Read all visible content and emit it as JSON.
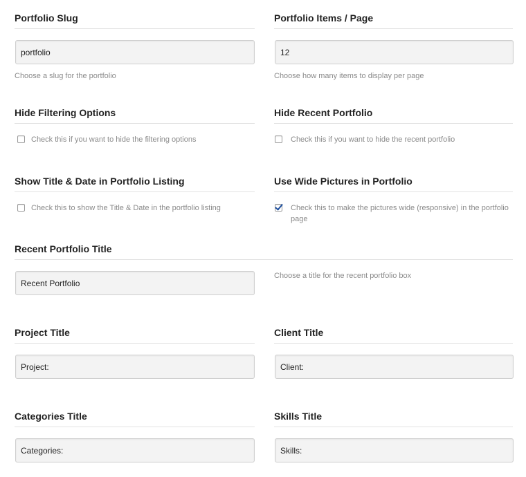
{
  "fields": {
    "portfolio_slug": {
      "title": "Portfolio Slug",
      "value": "portfolio",
      "description": "Choose a slug for the portfolio"
    },
    "items_per_page": {
      "title": "Portfolio Items / Page",
      "value": "12",
      "description": "Choose how many items to display per page"
    },
    "hide_filtering": {
      "title": "Hide Filtering Options",
      "checked": false,
      "description": "Check this if you want to hide the filtering options"
    },
    "hide_recent": {
      "title": "Hide Recent Portfolio",
      "checked": false,
      "description": "Check this if you want to hide the recent portfolio"
    },
    "show_title_date": {
      "title": "Show Title & Date in Portfolio Listing",
      "checked": false,
      "description": "Check this to show the Title & Date in the portfolio listing"
    },
    "wide_pictures": {
      "title": "Use Wide Pictures in Portfolio",
      "checked": true,
      "description": "Check this to make the pictures wide (responsive) in the portfolio page"
    },
    "recent_title": {
      "title": "Recent Portfolio Title",
      "value": "Recent Portfolio",
      "description": "Choose a title for the recent portfolio box"
    },
    "project_title": {
      "title": "Project Title",
      "value": "Project:"
    },
    "client_title": {
      "title": "Client Title",
      "value": "Client:"
    },
    "categories_title": {
      "title": "Categories Title",
      "value": "Categories:"
    },
    "skills_title": {
      "title": "Skills Title",
      "value": "Skills:"
    }
  },
  "colors": {
    "check_accent": "#1e4f9e",
    "input_background": "#f3f3f3",
    "description_text": "#8a8a8a"
  }
}
